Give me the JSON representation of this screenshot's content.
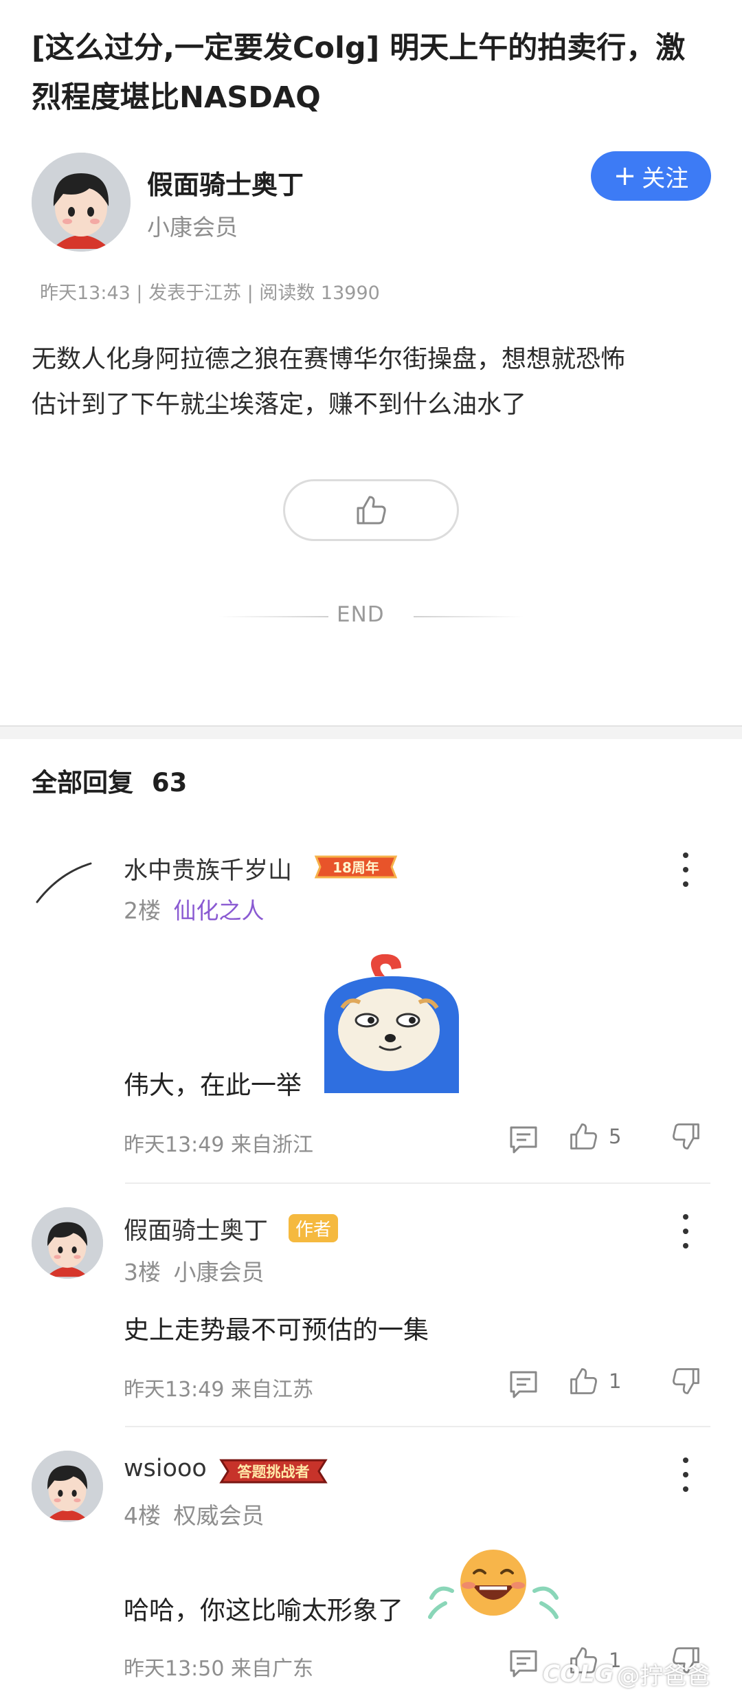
{
  "post": {
    "title": "[这么过分,一定要发Colg] 明天上午的拍卖行，激烈程度堪比NASDAQ",
    "author": {
      "name": "假面骑士奥丁",
      "level": "小康会员"
    },
    "follow_label": "关注",
    "follow_icon": "plus-icon",
    "meta": "昨天13:43 | 发表于江苏 | 阅读数 13990",
    "body_lines": [
      "无数人化身阿拉德之狼在赛博华尔街操盘，想想就恐怖",
      "估计到了下午就尘埃落定，赚不到什么油水了"
    ],
    "end_label": "END"
  },
  "replies": {
    "label": "全部回复",
    "count": "63",
    "items": [
      {
        "user": "水中贵族千岁山",
        "badge": "18周年",
        "floor": "2楼",
        "level": "仙化之人",
        "text": "伟大，在此一举",
        "time": "昨天13:49 来自浙江",
        "likes": "5"
      },
      {
        "user": "假面骑士奥丁",
        "badge": "作者",
        "floor": "3楼",
        "level": "小康会员",
        "text": "史上走势最不可预估的一集",
        "time": "昨天13:49 来自江苏",
        "likes": "1"
      },
      {
        "user": "wsiooo",
        "badge": "答题挑战者",
        "floor": "4楼",
        "level": "权威会员",
        "text": "哈哈，你这比喻太形象了",
        "time": "昨天13:50 来自广东",
        "likes": "1"
      }
    ]
  },
  "watermark": {
    "logo": "COLG",
    "handle": "@拧爸爸"
  },
  "colors": {
    "accent": "#3d7bf5",
    "author_badge": "#f5b93f",
    "level_purple": "#8a5ad2",
    "anniversary_badge": "#e8542a",
    "challenger_badge": "#c7332a"
  }
}
